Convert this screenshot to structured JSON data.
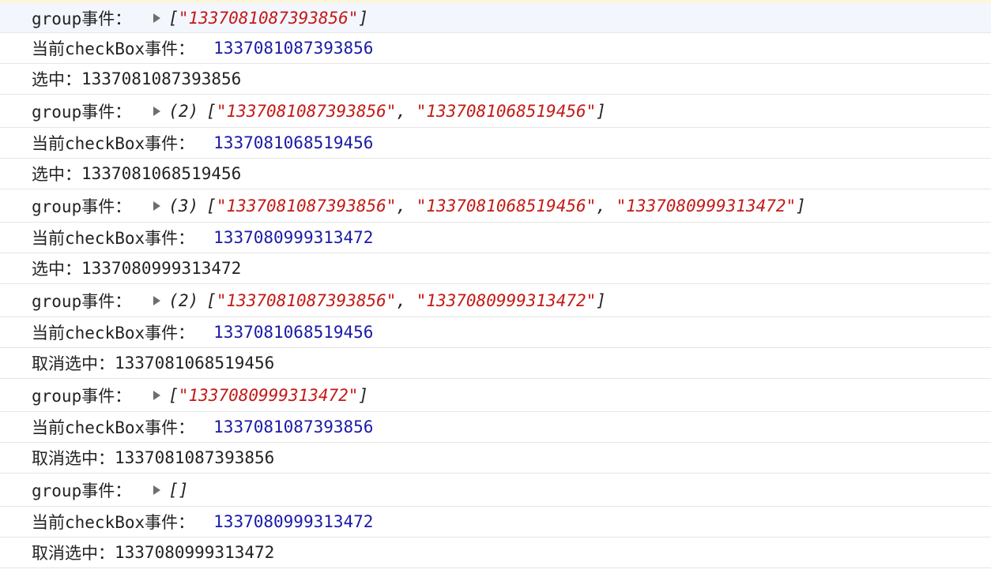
{
  "console": {
    "group_label": "group事件：",
    "checkbox_label": "当前checkBox事件：",
    "select_label": "选中：",
    "deselect_label": "取消选中：",
    "entries": [
      {
        "group": {
          "count": "",
          "items": [
            "1337081087393856"
          ]
        },
        "checkbox_id": "1337081087393856",
        "action_label": "选中：",
        "action_id": "1337081087393856"
      },
      {
        "group": {
          "count": "(2)",
          "items": [
            "1337081087393856",
            "1337081068519456"
          ]
        },
        "checkbox_id": "1337081068519456",
        "action_label": "选中：",
        "action_id": "1337081068519456"
      },
      {
        "group": {
          "count": "(3)",
          "items": [
            "1337081087393856",
            "1337081068519456",
            "1337080999313472"
          ]
        },
        "checkbox_id": "1337080999313472",
        "action_label": "选中：",
        "action_id": "1337080999313472"
      },
      {
        "group": {
          "count": "(2)",
          "items": [
            "1337081087393856",
            "1337080999313472"
          ]
        },
        "checkbox_id": "1337081068519456",
        "action_label": "取消选中：",
        "action_id": "1337081068519456"
      },
      {
        "group": {
          "count": "",
          "items": [
            "1337080999313472"
          ]
        },
        "checkbox_id": "1337081087393856",
        "action_label": "取消选中：",
        "action_id": "1337081087393856"
      },
      {
        "group": {
          "count": "",
          "items": []
        },
        "checkbox_id": "1337080999313472",
        "action_label": "取消选中：",
        "action_id": "1337080999313472"
      }
    ]
  },
  "colors": {
    "number": "#1a1aa6",
    "string": "#c41a16",
    "highlight_row": "#f3f6fd",
    "top_strip": "#fbf6dc"
  },
  "icons": {
    "toggle": "triangle-right-icon"
  }
}
